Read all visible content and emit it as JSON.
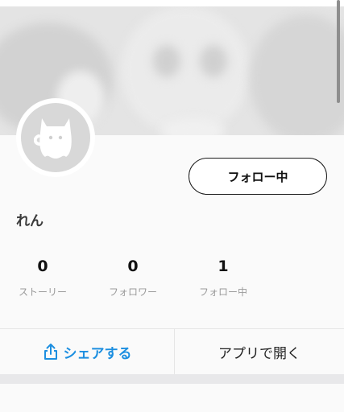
{
  "profile": {
    "username": "れん",
    "follow_label": "フォロー中"
  },
  "stats": [
    {
      "value": "0",
      "label": "ストーリー"
    },
    {
      "value": "0",
      "label": "フォロワー"
    },
    {
      "value": "1",
      "label": "フォロー中"
    }
  ],
  "actions": {
    "share_label": "シェアする",
    "open_app_label": "アプリで開く"
  },
  "colors": {
    "accent": "#1d8fe0",
    "background": "#fafafa"
  },
  "icons": {
    "share": "share-icon",
    "avatar": "ghost-cat-icon"
  }
}
